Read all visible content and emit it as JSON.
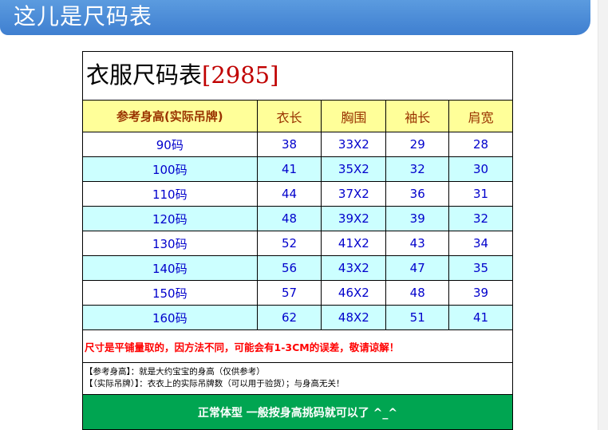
{
  "banner": {
    "title": "这儿是尺码表"
  },
  "table": {
    "title": "衣服尺码表",
    "code": "[2985]",
    "headers": [
      "参考身高(实际吊牌)",
      "衣长",
      "胸围",
      "袖长",
      "肩宽"
    ],
    "rows": [
      [
        "90码",
        "38",
        "33X2",
        "29",
        "28"
      ],
      [
        "100码",
        "41",
        "35X2",
        "32",
        "30"
      ],
      [
        "110码",
        "44",
        "37X2",
        "36",
        "31"
      ],
      [
        "120码",
        "48",
        "39X2",
        "39",
        "32"
      ],
      [
        "130码",
        "52",
        "41X2",
        "43",
        "34"
      ],
      [
        "140码",
        "56",
        "43X2",
        "47",
        "35"
      ],
      [
        "150码",
        "57",
        "46X2",
        "48",
        "39"
      ],
      [
        "160码",
        "62",
        "48X2",
        "51",
        "41"
      ]
    ],
    "warning": "尺寸是平铺量取的，因方法不同，可能会有1-3CM的误差，敬请谅解！",
    "notes": [
      "【参考身高】：就是大约宝宝的身高（仅供参考）",
      "【（实际吊牌）】：衣衣上的实际吊牌数（可以用于验货）；与身高无关！"
    ],
    "footer": "正常体型  一般按身高挑码就可以了   ^_^"
  },
  "colors": {
    "banner": "#4a8ad6",
    "header_bg": "#ffff99",
    "header_text": "#993300",
    "alt_row": "#ccffff",
    "cell_text": "#0000cc",
    "warning_text": "#ff0000",
    "footer_bg": "#00a551",
    "title_code": "#c00000"
  }
}
